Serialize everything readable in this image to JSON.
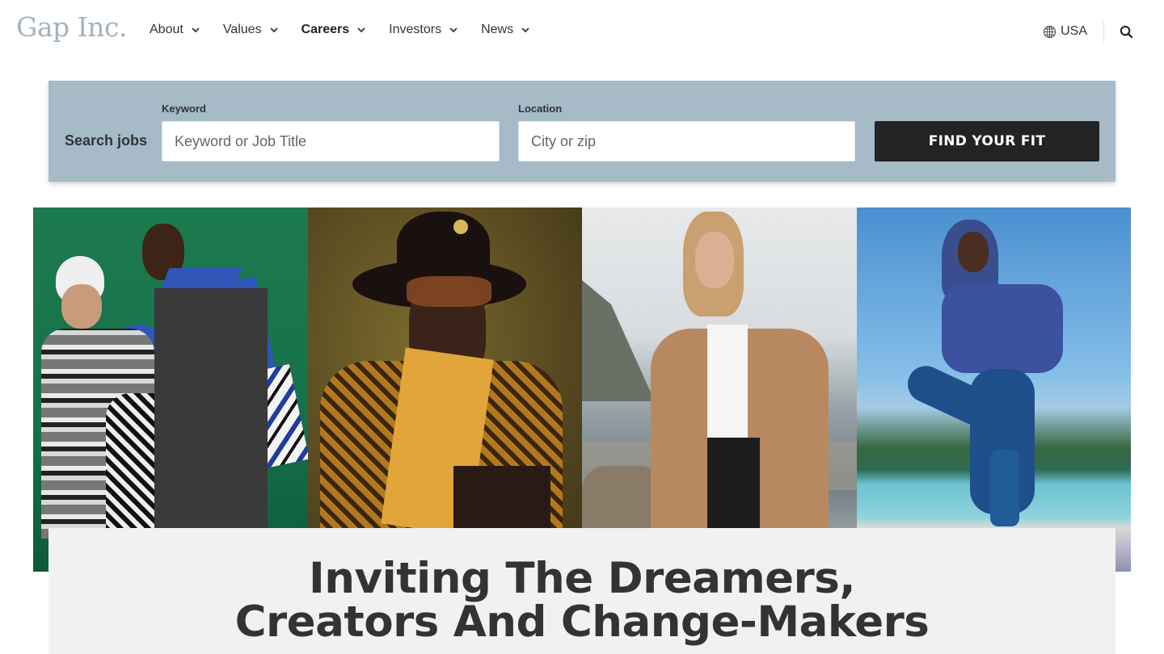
{
  "header": {
    "logo": "Gap Inc.",
    "nav": [
      {
        "label": "About",
        "active": false
      },
      {
        "label": "Values",
        "active": false
      },
      {
        "label": "Careers",
        "active": true
      },
      {
        "label": "Investors",
        "active": false
      },
      {
        "label": "News",
        "active": false
      }
    ],
    "locale": {
      "icon": "globe-icon",
      "label": "USA"
    },
    "search_icon": "search-icon"
  },
  "search": {
    "title": "Search jobs",
    "keyword": {
      "label": "Keyword",
      "placeholder": "Keyword or Job Title",
      "value": ""
    },
    "location": {
      "label": "Location",
      "placeholder": "City or zip",
      "value": ""
    },
    "submit_label": "FIND YOUR FIT"
  },
  "hero": {
    "images": [
      {
        "alt": "Family in fair isle sweaters and blue knit scarf and hat on green background"
      },
      {
        "alt": "Man in black hat, tinted glasses and gold patterned scarf with GAP logo"
      },
      {
        "alt": "Woman in camel coat and white tee by a mountain lake"
      },
      {
        "alt": "Woman in blue hoodie and leggings in yoga tree pose on a dock by a lake"
      }
    ]
  },
  "headline": {
    "line1": "Inviting The Dreamers,",
    "line2": "Creators And Change-Makers"
  },
  "colors": {
    "search_panel": "#a6bac7",
    "button": "#232323",
    "logo": "#a3b3bf",
    "headline_card": "#f1f1f1"
  }
}
